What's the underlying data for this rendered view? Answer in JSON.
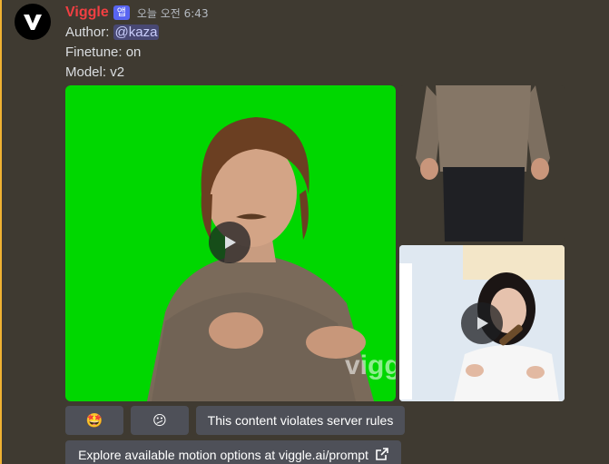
{
  "message": {
    "username": "Viggle",
    "badge": "앱",
    "timestamp": "오늘 오전 6:43",
    "author_label": "Author: ",
    "author_mention": "@kaza",
    "finetune_line": "Finetune: on",
    "model_line": "Model: v2"
  },
  "media": {
    "watermark": "vigg"
  },
  "buttons": {
    "reaction_1": "🤩",
    "reaction_2": "😕",
    "report": "This content violates server rules",
    "explore": "Explore available motion options at viggle.ai/prompt"
  },
  "colors": {
    "background": "#3f3a31",
    "username": "#f23f42",
    "badge": "#5865f2",
    "green_screen": "#00d700",
    "button": "#4e5058",
    "accent": "#f0b232"
  },
  "icons": {
    "avatar": "viggle-logo-icon",
    "play": "play-icon",
    "external": "external-link-icon"
  }
}
